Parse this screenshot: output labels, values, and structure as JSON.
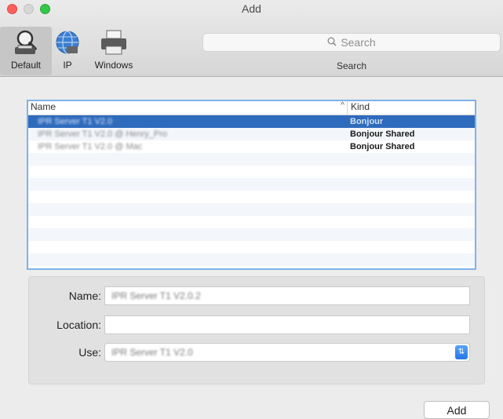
{
  "window": {
    "title": "Add"
  },
  "toolbar": {
    "items": [
      {
        "label": "Default",
        "icon": "default-printer-icon",
        "selected": true
      },
      {
        "label": "IP",
        "icon": "globe-icon",
        "selected": false
      },
      {
        "label": "Windows",
        "icon": "printer-icon",
        "selected": false
      }
    ],
    "search": {
      "placeholder": "Search",
      "label": "Search"
    }
  },
  "list": {
    "columns": {
      "name": "Name",
      "kind": "Kind",
      "sort_icon": "sort-ascending-icon"
    },
    "rows": [
      {
        "name": "IPR Server T1 V2.0",
        "kind": "Bonjour",
        "selected": true
      },
      {
        "name": "IPR Server T1 V2.0 @ Henry_Pro",
        "kind": "Bonjour Shared",
        "selected": false
      },
      {
        "name": "IPR Server T1 V2.0 @ Mac",
        "kind": "Bonjour Shared",
        "selected": false
      }
    ]
  },
  "form": {
    "name_label": "Name:",
    "name_value": "IPR Server T1 V2.0.2",
    "location_label": "Location:",
    "location_value": "",
    "use_label": "Use:",
    "use_value": "IPR Server T1 V2.0"
  },
  "actions": {
    "add_label": "Add"
  },
  "colors": {
    "selection": "#2f6bbd",
    "focus_ring": "#7fb2e8",
    "close": "#fc605b",
    "zoom": "#35c848"
  }
}
